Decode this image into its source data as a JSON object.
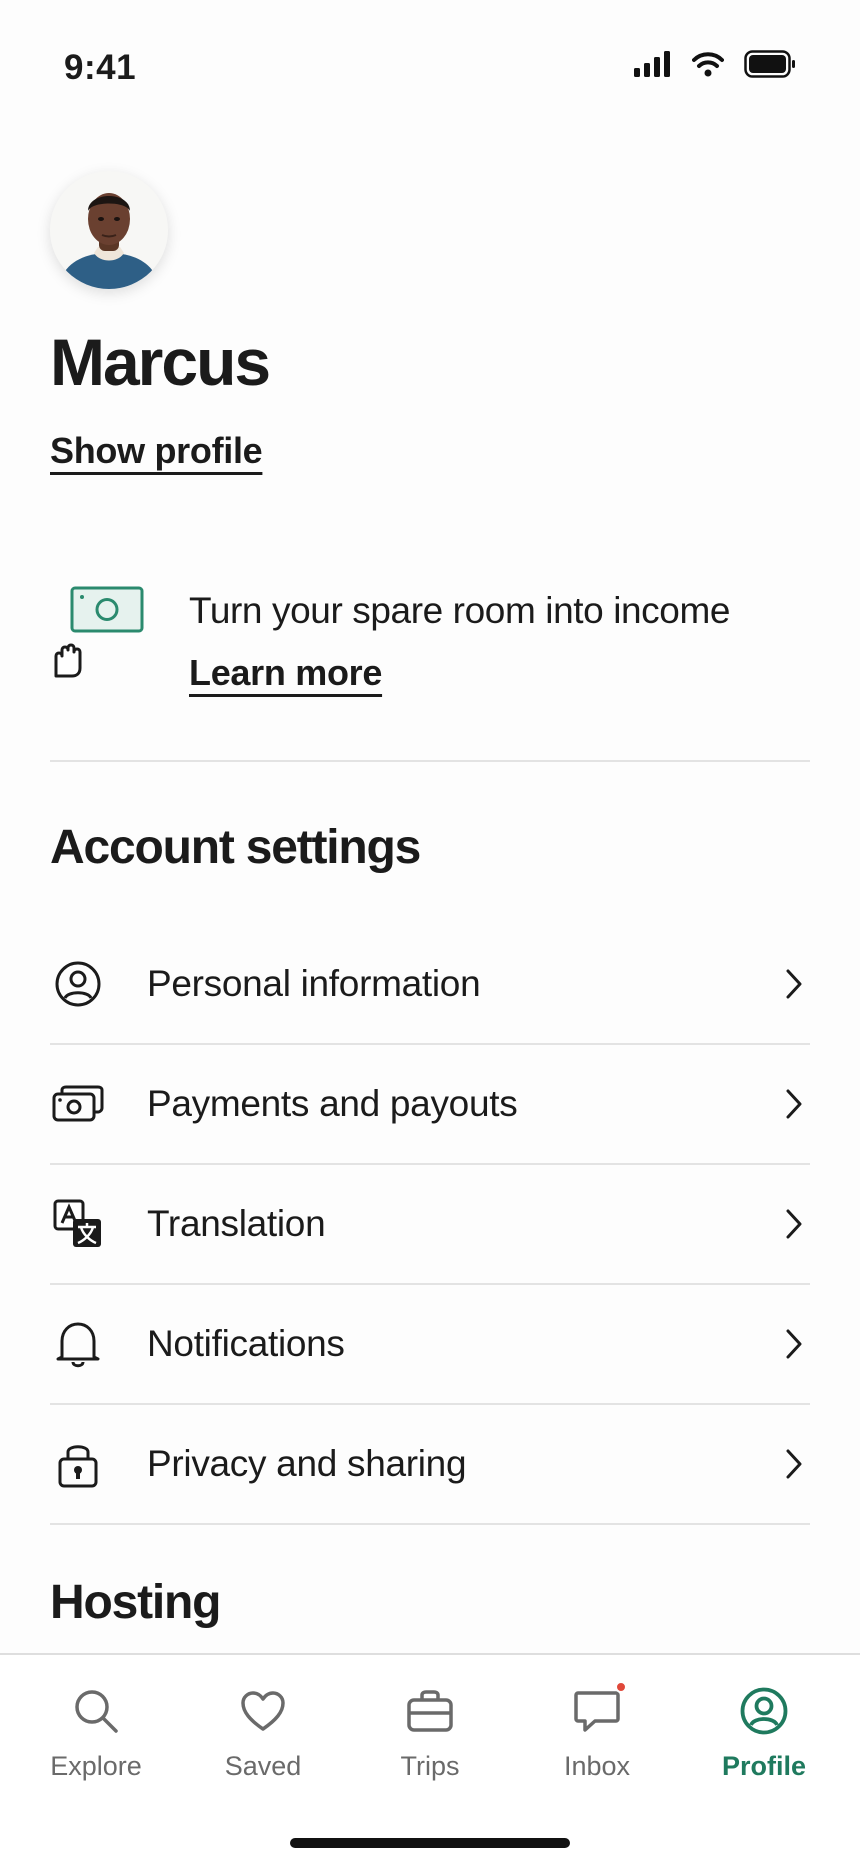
{
  "status_bar": {
    "time": "9:41"
  },
  "profile": {
    "name": "Marcus",
    "show_profile_label": "Show profile"
  },
  "promo": {
    "text": "Turn your spare room into income",
    "link_label": "Learn more",
    "accent_color": "#2b8a6e"
  },
  "account_settings": {
    "title": "Account settings",
    "items": [
      {
        "label": "Personal information",
        "icon": "user-circle-icon"
      },
      {
        "label": "Payments and payouts",
        "icon": "banknotes-icon"
      },
      {
        "label": "Translation",
        "icon": "translate-icon"
      },
      {
        "label": "Notifications",
        "icon": "bell-icon"
      },
      {
        "label": "Privacy and sharing",
        "icon": "lock-icon"
      }
    ]
  },
  "hosting": {
    "title": "Hosting"
  },
  "tab_bar": {
    "active_color": "#1f7a5e",
    "tabs": [
      {
        "label": "Explore",
        "icon": "search-icon"
      },
      {
        "label": "Saved",
        "icon": "heart-icon"
      },
      {
        "label": "Trips",
        "icon": "briefcase-icon"
      },
      {
        "label": "Inbox",
        "icon": "chat-bubble-icon",
        "badge": true
      },
      {
        "label": "Profile",
        "icon": "profile-icon",
        "active": true
      }
    ]
  }
}
